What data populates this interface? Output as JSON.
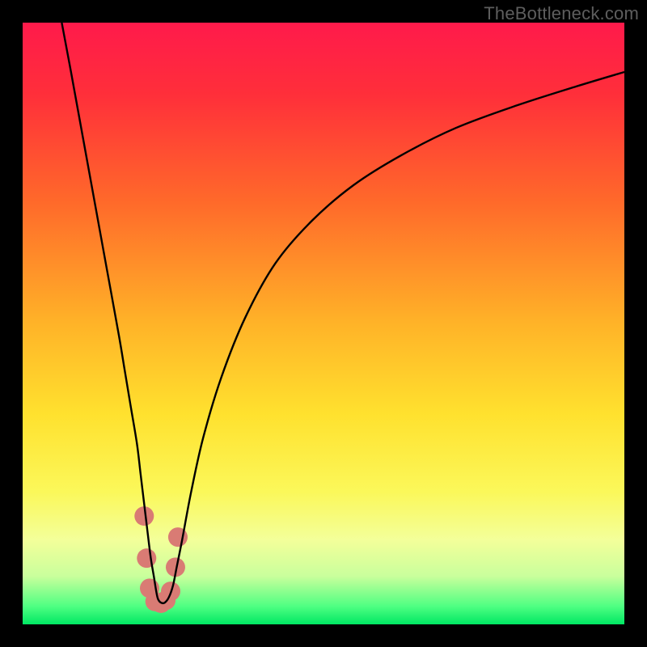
{
  "watermark": "TheBottleneck.com",
  "chart_data": {
    "type": "line",
    "title": "",
    "xlabel": "",
    "ylabel": "",
    "xlim": [
      0,
      100
    ],
    "ylim": [
      0,
      100
    ],
    "gradient_stops": [
      {
        "offset": 0.0,
        "color": "#ff1a4b"
      },
      {
        "offset": 0.12,
        "color": "#ff2f3a"
      },
      {
        "offset": 0.3,
        "color": "#ff6a2a"
      },
      {
        "offset": 0.5,
        "color": "#ffb328"
      },
      {
        "offset": 0.65,
        "color": "#ffe12e"
      },
      {
        "offset": 0.78,
        "color": "#fbf85a"
      },
      {
        "offset": 0.86,
        "color": "#f3ff9a"
      },
      {
        "offset": 0.92,
        "color": "#c9ff9c"
      },
      {
        "offset": 0.97,
        "color": "#4fff82"
      },
      {
        "offset": 1.0,
        "color": "#00e763"
      }
    ],
    "series": [
      {
        "name": "bottleneck-curve",
        "color": "#000000",
        "stroke_width": 2.4,
        "x": [
          6.5,
          8,
          10,
          12,
          14,
          16,
          17,
          18,
          19,
          19.6,
          20.2,
          20.8,
          21.3,
          21.8,
          22.2,
          22.5,
          23.0,
          23.6,
          24.3,
          25.0,
          25.6,
          26.5,
          28,
          30,
          33,
          37,
          42,
          48,
          55,
          63,
          72,
          82,
          92,
          100
        ],
        "y": [
          100,
          92,
          81,
          70,
          59,
          48,
          42,
          36,
          30,
          25,
          20,
          15,
          11,
          8,
          5.5,
          4.2,
          3.6,
          3.6,
          4.5,
          6.5,
          9.5,
          14,
          22,
          31,
          41,
          51,
          60,
          67,
          73,
          78,
          82.5,
          86.2,
          89.4,
          91.8
        ]
      }
    ],
    "marker_cluster": {
      "color": "#d97b74",
      "radius": 12,
      "points": [
        {
          "x": 20.2,
          "y": 18
        },
        {
          "x": 20.6,
          "y": 11
        },
        {
          "x": 21.1,
          "y": 6
        },
        {
          "x": 22.0,
          "y": 3.8
        },
        {
          "x": 23.0,
          "y": 3.5
        },
        {
          "x": 23.8,
          "y": 4
        },
        {
          "x": 24.6,
          "y": 5.5
        },
        {
          "x": 25.4,
          "y": 9.5
        },
        {
          "x": 25.8,
          "y": 14.5
        }
      ]
    }
  }
}
